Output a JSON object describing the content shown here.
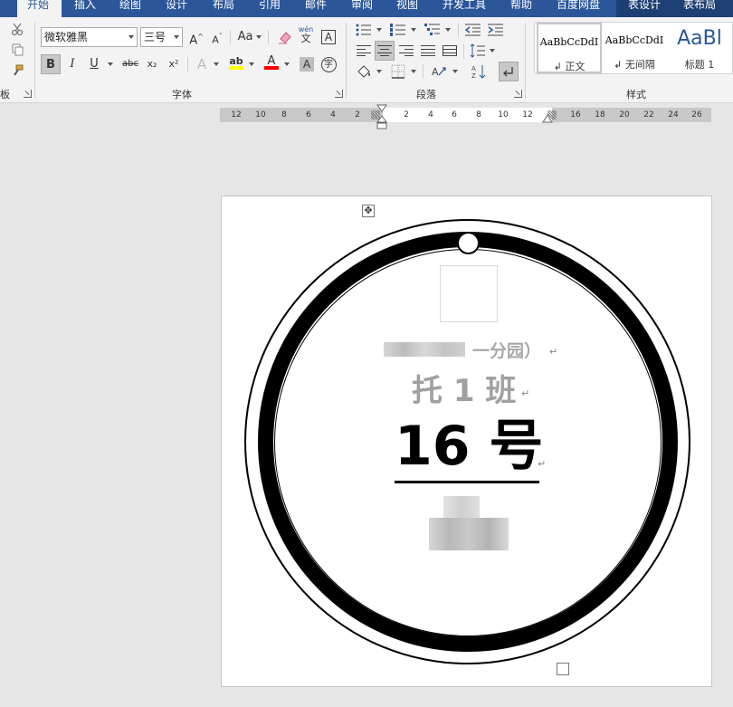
{
  "tabs": [
    {
      "label": "开始",
      "active": true
    },
    {
      "label": "插入"
    },
    {
      "label": "绘图"
    },
    {
      "label": "设计"
    },
    {
      "label": "布局"
    },
    {
      "label": "引用"
    },
    {
      "label": "邮件"
    },
    {
      "label": "审阅"
    },
    {
      "label": "视图"
    },
    {
      "label": "开发工具"
    },
    {
      "label": "帮助"
    },
    {
      "label": "百度网盘"
    },
    {
      "label": "表设计"
    },
    {
      "label": "表布局"
    }
  ],
  "ribbon": {
    "clipboard_label": "板",
    "font_label": "字体",
    "paragraph_label": "段落",
    "styles_label": "样式",
    "font_name": "微软雅黑",
    "font_size": "三号",
    "grow_font": "A",
    "shrink_font": "A",
    "change_case": "Aa",
    "wen_top": "wén",
    "wen_bottom": "文",
    "border_char": "A",
    "bold": "B",
    "italic": "I",
    "underline": "U",
    "strike": "abc",
    "subscript": "x₂",
    "superscript": "x²",
    "text_effects": "A",
    "highlight": "ab",
    "font_color": "A",
    "char_shading": "A",
    "enclose_char": "字",
    "highlight_color": "#ffff00",
    "font_color_value": "#ff0000",
    "styles": [
      {
        "sample": "AaBbCcDdI",
        "name": "↲ 正文",
        "selected": true
      },
      {
        "sample": "AaBbCcDdI",
        "name": "↲ 无间隔"
      },
      {
        "sample": "AaBl",
        "name": "标题 1"
      }
    ]
  },
  "ruler": {
    "left_ticks": [
      "12",
      "10",
      "8",
      "6",
      "4",
      "2"
    ],
    "mid_ticks": [
      "2",
      "4",
      "6",
      "8",
      "10",
      "12"
    ],
    "right_ticks": [
      "16",
      "18",
      "20",
      "22",
      "24",
      "26"
    ]
  },
  "document": {
    "kindergarten": "一分园）",
    "class_name": "托 1 班",
    "number": "16 号",
    "para_mark": "↵"
  },
  "colors": {
    "accent": "#2b579a",
    "ribbon_bg": "#f3f3f3",
    "canvas_bg": "#e6e6e6"
  }
}
